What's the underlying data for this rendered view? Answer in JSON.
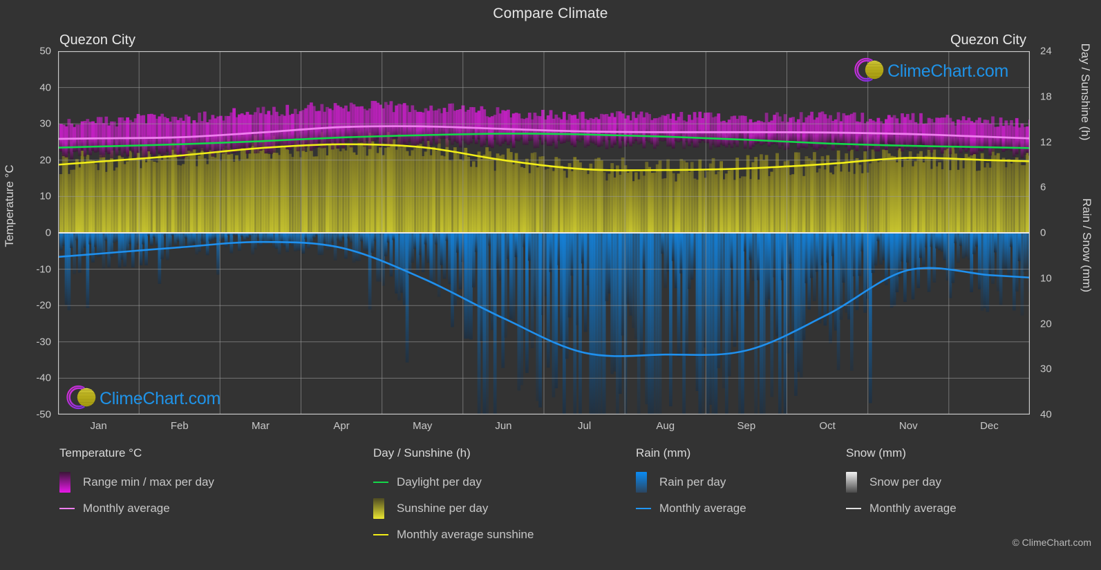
{
  "header": {
    "title": "Compare Climate",
    "city_left": "Quezon City",
    "city_right": "Quezon City"
  },
  "branding": {
    "logo_text": "ClimeChart.com",
    "copyright": "© ClimeChart.com",
    "logo_blue": "#1f93e8",
    "logo_magenta": "#d02fd0",
    "logo_purple": "#7a2fe0",
    "logo_yellow": "#e8e02c"
  },
  "colors": {
    "background": "#333333",
    "grid": "#9b9b9b",
    "axis": "#c8c8c8",
    "text": "#d8d8d8",
    "temp_band_top": "#c21fc2",
    "temp_band_bottom": "#3b1638",
    "temp_avg_line": "#ef7fef",
    "daylight_line": "#14d84a",
    "sunshine_fill_top": "#7d7623",
    "sunshine_fill_bottom": "#c9c62e",
    "sunshine_avg_line": "#f2ee18",
    "rain_fill_top": "#1383dd",
    "rain_fill_bottom": "#203040",
    "rain_avg_line": "#1f90ee",
    "snow_fill": "#d8d8d8"
  },
  "axes": {
    "left": {
      "title": "Temperature °C",
      "ticks": [
        50,
        40,
        30,
        20,
        10,
        0,
        -10,
        -20,
        -30,
        -40,
        -50
      ],
      "min": -50,
      "max": 50
    },
    "right_top": {
      "title": "Day / Sunshine (h)",
      "ticks": [
        24,
        18,
        12,
        6,
        0
      ],
      "min": 0,
      "max": 24
    },
    "right_bottom": {
      "title": "Rain / Snow (mm)",
      "ticks": [
        0,
        10,
        20,
        30,
        40
      ],
      "min": 0,
      "max": 40
    },
    "x": {
      "ticks": [
        "Jan",
        "Feb",
        "Mar",
        "Apr",
        "May",
        "Jun",
        "Jul",
        "Aug",
        "Sep",
        "Oct",
        "Nov",
        "Dec"
      ]
    }
  },
  "legend": {
    "groups": [
      {
        "title": "Temperature °C",
        "items": [
          {
            "label": "Range min / max per day",
            "marker": "gradient-box",
            "color_top": "#3b1638",
            "color_bottom": "#e818e8"
          },
          {
            "label": "Monthly average",
            "marker": "line",
            "color": "#ef7fef"
          }
        ]
      },
      {
        "title": "Day / Sunshine (h)",
        "items": [
          {
            "label": "Daylight per day",
            "marker": "line",
            "color": "#14d84a"
          },
          {
            "label": "Sunshine per day",
            "marker": "gradient-box",
            "color_top": "#4d4a22",
            "color_bottom": "#eae632"
          },
          {
            "label": "Monthly average sunshine",
            "marker": "line",
            "color": "#f2ee18"
          }
        ]
      },
      {
        "title": "Rain (mm)",
        "items": [
          {
            "label": "Rain per day",
            "marker": "gradient-box",
            "color_top": "#0a8cf5",
            "color_bottom": "#2b4560"
          },
          {
            "label": "Monthly average",
            "marker": "line",
            "color": "#2196f3"
          }
        ]
      },
      {
        "title": "Snow (mm)",
        "items": [
          {
            "label": "Snow per day",
            "marker": "gradient-box",
            "color_top": "#f2f2f2",
            "color_bottom": "#4a4a4a"
          },
          {
            "label": "Monthly average",
            "marker": "line",
            "color": "#e0e0e0"
          }
        ]
      }
    ]
  },
  "chart_data": {
    "type": "area",
    "title": "Compare Climate",
    "subtitle": "Quezon City",
    "xlabel": "",
    "ylabel": "Temperature °C",
    "categories": [
      "Jan",
      "Feb",
      "Mar",
      "Apr",
      "May",
      "Jun",
      "Jul",
      "Aug",
      "Sep",
      "Oct",
      "Nov",
      "Dec"
    ],
    "axis_ranges": {
      "temperature_c": [
        -50,
        50
      ],
      "day_sunshine_h": [
        0,
        24
      ],
      "rain_snow_mm": [
        0,
        40
      ]
    },
    "grid": true,
    "legend_position": "bottom",
    "series": [
      {
        "name": "Monthly average temperature (°C)",
        "unit": "°C",
        "axis": "left",
        "color": "#ef7fef",
        "values": [
          26.0,
          26.3,
          27.6,
          29.1,
          29.3,
          28.6,
          27.9,
          27.7,
          27.7,
          27.6,
          27.2,
          26.4
        ]
      },
      {
        "name": "Daily max temperature (°C)",
        "unit": "°C",
        "axis": "left",
        "color": "#c21fc2",
        "values": [
          30.5,
          31.3,
          33.0,
          34.6,
          34.3,
          32.8,
          31.8,
          31.5,
          31.7,
          31.6,
          31.2,
          30.5
        ]
      },
      {
        "name": "Daily min temperature (°C)",
        "unit": "°C",
        "axis": "left",
        "color": "#3b1638",
        "values": [
          21.6,
          21.8,
          22.8,
          24.2,
          24.8,
          24.6,
          24.3,
          24.2,
          24.2,
          23.9,
          23.3,
          22.3
        ]
      },
      {
        "name": "Daylight per day (h)",
        "unit": "h",
        "axis": "right_top",
        "color": "#14d84a",
        "values": [
          11.4,
          11.7,
          12.1,
          12.6,
          12.9,
          13.1,
          13.0,
          12.7,
          12.3,
          11.8,
          11.5,
          11.3
        ]
      },
      {
        "name": "Monthly average sunshine (h)",
        "unit": "h",
        "axis": "right_top",
        "color": "#f2ee18",
        "values": [
          9.4,
          10.2,
          11.2,
          11.7,
          11.3,
          9.6,
          8.4,
          8.3,
          8.5,
          9.1,
          9.9,
          9.6
        ]
      },
      {
        "name": "Monthly average rain (mm)",
        "unit": "mm",
        "axis": "right_bottom",
        "color": "#2196f3",
        "values": [
          4.6,
          3.2,
          2.0,
          3.3,
          10.0,
          18.8,
          26.4,
          26.8,
          25.9,
          18.0,
          8.2,
          9.3
        ]
      },
      {
        "name": "Monthly average snow (mm)",
        "unit": "mm",
        "axis": "right_bottom",
        "color": "#e0e0e0",
        "values": [
          0,
          0,
          0,
          0,
          0,
          0,
          0,
          0,
          0,
          0,
          0,
          0
        ]
      }
    ]
  }
}
